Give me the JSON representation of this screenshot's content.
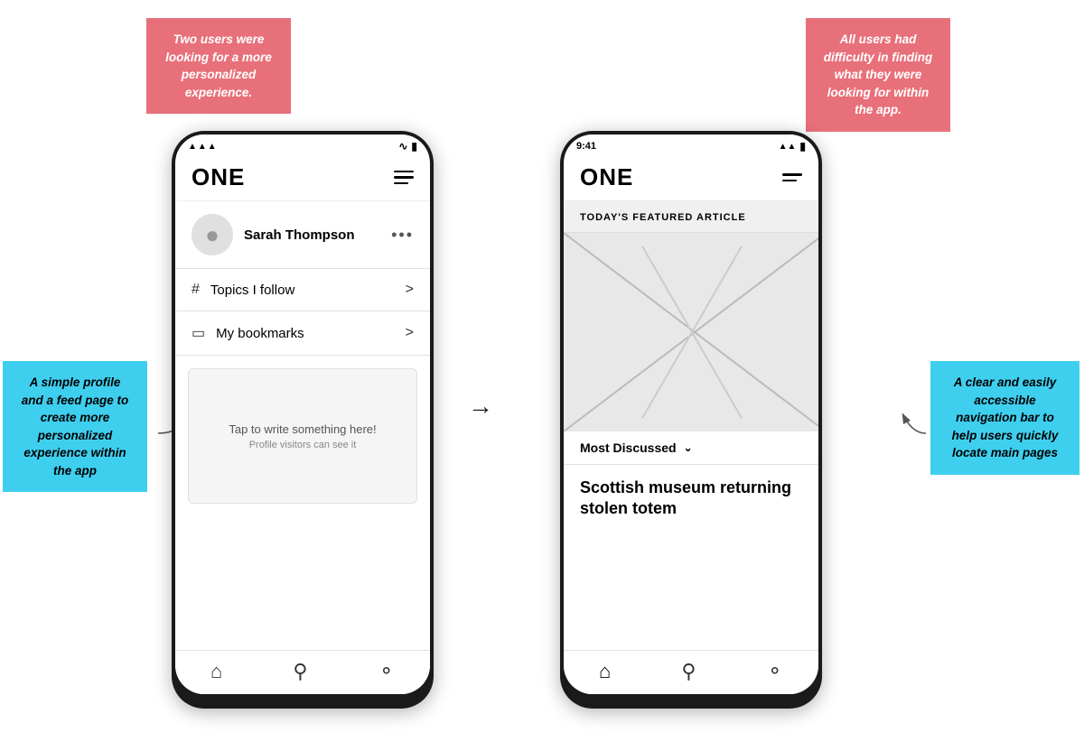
{
  "sticky": {
    "top_left": {
      "text": "Two users were looking for a more personalized experience."
    },
    "top_right": {
      "text": "All users had difficulty in finding what they were looking for within the app."
    },
    "mid_left": {
      "text": "A simple profile and a feed page to create more personalized experience within the app"
    },
    "mid_right": {
      "text": "A clear and easily accessible navigation bar to help users quickly locate main pages"
    }
  },
  "phone_left": {
    "status": {
      "signal": "▲▲▲",
      "wifi": "wifi",
      "battery": "battery"
    },
    "logo": "ONE",
    "user_name": "Sarah Thompson",
    "menu_items": [
      {
        "icon": "#",
        "label": "Topics I follow"
      },
      {
        "icon": "bookmark",
        "label": "My bookmarks"
      }
    ],
    "write_area": {
      "main": "Tap to write something here!",
      "sub": "Profile visitors can see it"
    },
    "nav": [
      "home",
      "search",
      "profile"
    ]
  },
  "phone_right": {
    "status": {
      "time": "9:41",
      "signal": "▲▲",
      "battery": "battery"
    },
    "logo": "ONE",
    "featured_label": "TODAY'S FEATURED ARTICLE",
    "most_discussed": "Most Discussed",
    "article_title": "Scottish museum returning stolen totem",
    "nav": [
      "home",
      "search",
      "profile"
    ]
  },
  "arrow": "→"
}
